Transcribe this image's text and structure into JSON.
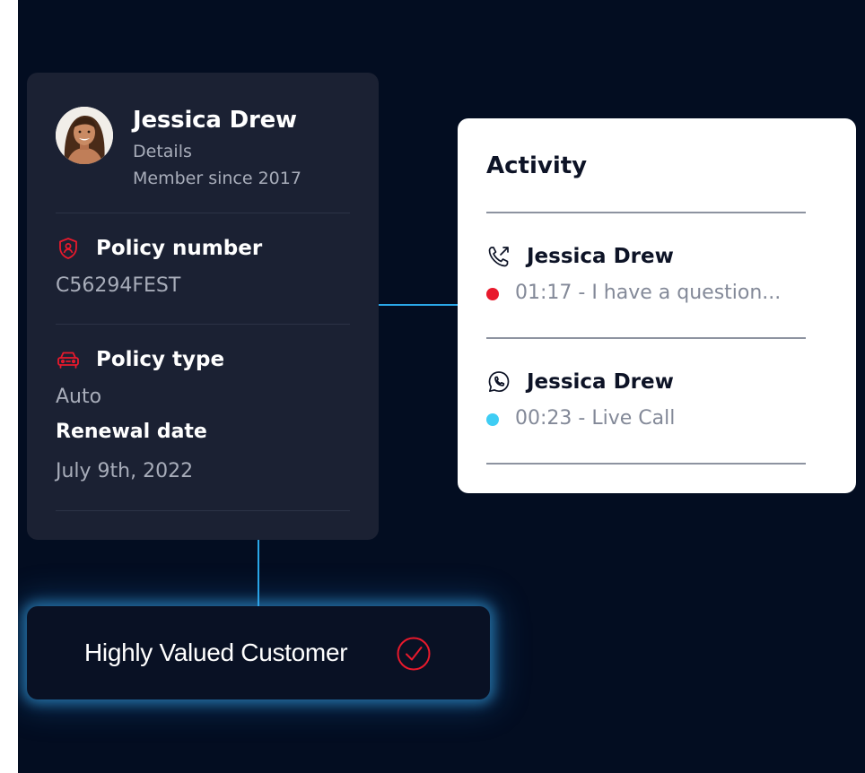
{
  "profile": {
    "name": "Jessica Drew",
    "detail_label": "Details",
    "member_since": "Member since 2017",
    "policy_number_label": "Policy number",
    "policy_number": "C56294FEST",
    "policy_type_label": "Policy type",
    "policy_type": "Auto",
    "renewal_label": "Renewal date",
    "renewal_date": "July 9th, 2022"
  },
  "activity": {
    "title": "Activity",
    "items": [
      {
        "name": "Jessica Drew",
        "message": "01:17 - I have a question...",
        "icon": "phone-outgoing-icon",
        "status_color": "#e8192c"
      },
      {
        "name": "Jessica Drew",
        "message": "00:23 - Live Call",
        "icon": "whatsapp-icon",
        "status_color": "#3fcdf4"
      }
    ]
  },
  "badge": {
    "text": "Highly Valued Customer",
    "icon": "check-circle-icon"
  },
  "colors": {
    "background": "#030d21",
    "card": "#1b2133",
    "accent_red": "#e8192c",
    "accent_cyan": "#3fcdf4",
    "connector": "#2aa7e8"
  }
}
